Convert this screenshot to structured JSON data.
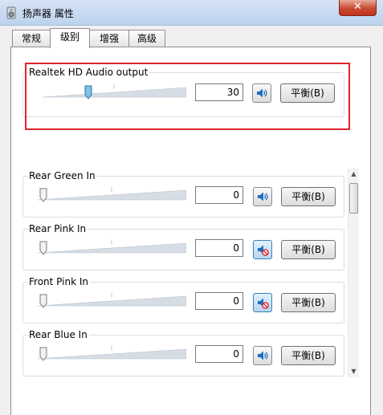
{
  "window": {
    "title": "扬声器 属性",
    "close_glyph": "✕"
  },
  "tabs": [
    {
      "label": "常规",
      "active": false
    },
    {
      "label": "级别",
      "active": true
    },
    {
      "label": "增强",
      "active": false
    },
    {
      "label": "高级",
      "active": false
    }
  ],
  "master": {
    "label": "Realtek HD Audio output",
    "volume": "30",
    "volume_fraction": 0.3,
    "muted": false,
    "balance_label": "平衡(B)"
  },
  "channels": [
    {
      "label": "Rear Green In",
      "volume": "0",
      "volume_fraction": 0,
      "muted": false,
      "balance_label": "平衡(B)"
    },
    {
      "label": "Rear Pink In",
      "volume": "0",
      "volume_fraction": 0,
      "muted": true,
      "balance_label": "平衡(B)"
    },
    {
      "label": "Front Pink In",
      "volume": "0",
      "volume_fraction": 0,
      "muted": true,
      "balance_label": "平衡(B)"
    },
    {
      "label": "Rear Blue In",
      "volume": "0",
      "volume_fraction": 0,
      "muted": false,
      "balance_label": "平衡(B)"
    }
  ],
  "icons": {
    "title": "speaker-icon",
    "mute": "speaker-volume-icon",
    "muted": "speaker-muted-icon"
  },
  "colors": {
    "highlight": "#e0242b",
    "accent": "#1f6fc1"
  }
}
